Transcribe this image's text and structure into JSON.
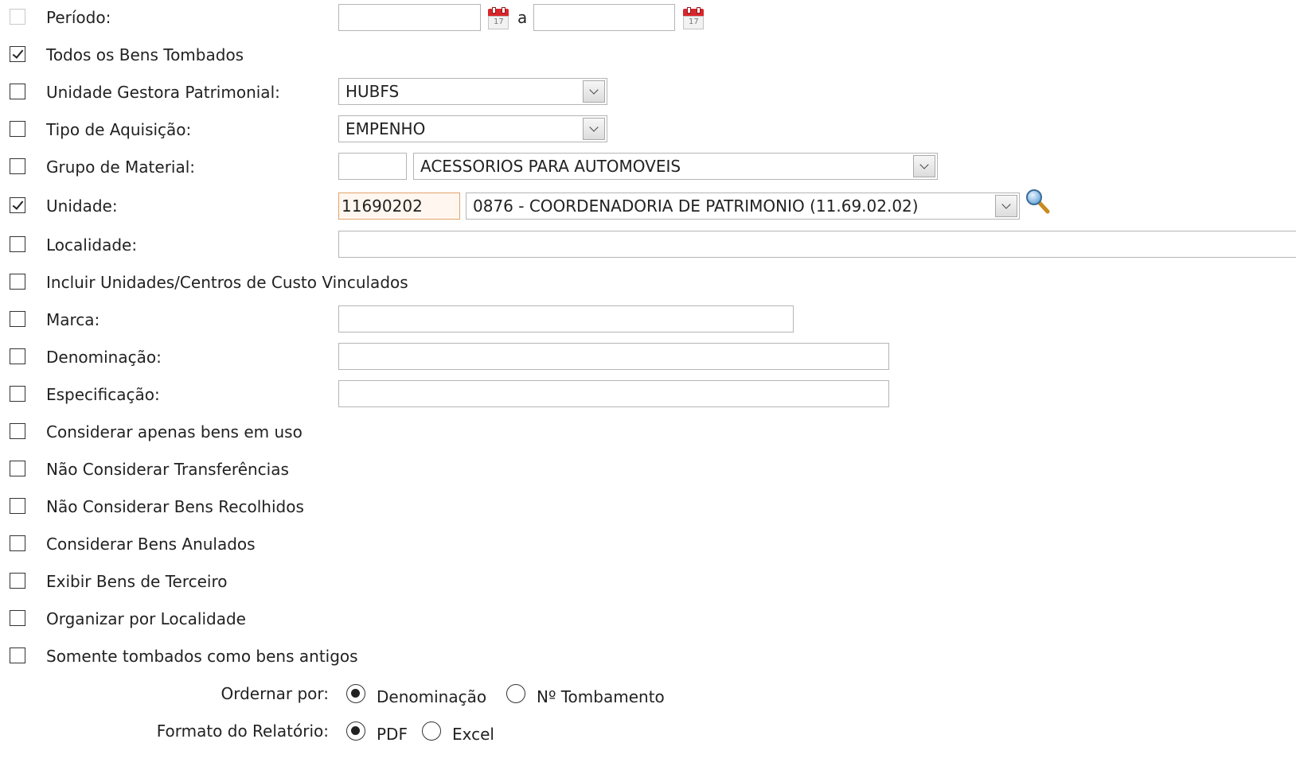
{
  "periodo": {
    "label": "Período:",
    "separator": "a",
    "start_value": "",
    "end_value": "",
    "checked": false,
    "disabled": true
  },
  "todos_bens": {
    "label": "Todos os Bens Tombados",
    "checked": true
  },
  "unidade_gestora": {
    "label": "Unidade Gestora Patrimonial:",
    "selected": "HUBFS",
    "checked": false
  },
  "tipo_aquisicao": {
    "label": "Tipo de Aquisição:",
    "selected": "EMPENHO",
    "checked": false
  },
  "grupo_material": {
    "label": "Grupo de Material:",
    "code_value": "",
    "selected": "ACESSORIOS PARA AUTOMOVEIS",
    "checked": false
  },
  "unidade": {
    "label": "Unidade:",
    "code_value": "11690202",
    "selected": "0876 - COORDENADORIA DE PATRIMONIO (11.69.02.02)",
    "checked": true
  },
  "localidade": {
    "label": "Localidade:",
    "value": "",
    "checked": false
  },
  "incluir_unidades": {
    "label": "Incluir Unidades/Centros de Custo Vinculados",
    "checked": false
  },
  "marca": {
    "label": "Marca:",
    "value": "",
    "checked": false
  },
  "denominacao": {
    "label": "Denominação:",
    "value": "",
    "checked": false
  },
  "especificacao": {
    "label": "Especificação:",
    "value": "",
    "checked": false
  },
  "options": [
    {
      "label": "Considerar apenas bens em uso",
      "checked": false
    },
    {
      "label": "Não Considerar Transferências",
      "checked": false
    },
    {
      "label": "Não Considerar Bens Recolhidos",
      "checked": false
    },
    {
      "label": "Considerar Bens Anulados",
      "checked": false
    },
    {
      "label": "Exibir Bens de Terceiro",
      "checked": false
    },
    {
      "label": "Organizar por Localidade",
      "checked": false
    },
    {
      "label": "Somente tombados como bens antigos",
      "checked": false
    }
  ],
  "ordenar": {
    "label": "Ordernar por:",
    "options": [
      "Denominação",
      "Nº Tombamento"
    ],
    "selected": "Denominação"
  },
  "formato": {
    "label": "Formato do Relatório:",
    "options": [
      "PDF",
      "Excel"
    ],
    "selected": "PDF"
  },
  "icons": {
    "calendar": "calendar-icon",
    "search": "magnifier-icon"
  }
}
